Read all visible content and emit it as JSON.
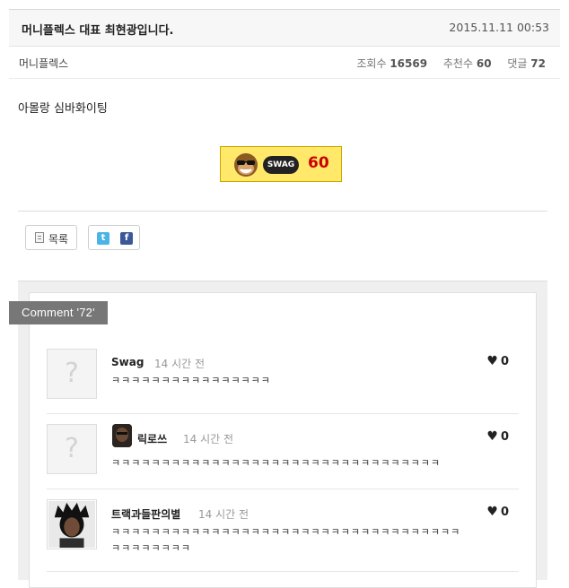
{
  "post": {
    "title": "머니플렉스 대표 최현광입니다.",
    "date": "2015.11.11 00:53",
    "author": "머니플렉스",
    "views_label": "조회수",
    "views": "16569",
    "recommend_label": "추천수",
    "recommend": "60",
    "comments_label": "댓글",
    "comments": "72",
    "body": "아몰랑 심바화이팅"
  },
  "swag": {
    "label": "SWAG",
    "count": "60"
  },
  "buttons": {
    "list_label": "목록",
    "twitter": "t",
    "facebook": "f"
  },
  "comment_section": {
    "tab_label": "Comment '72'",
    "items": [
      {
        "name": "Swag",
        "time": "14 시간 전",
        "likes": "0",
        "text": "ㅋㅋㅋㅋㅋㅋㅋㅋㅋㅋㅋㅋㅋㅋㅋㅋ"
      },
      {
        "name": "릭로쓰",
        "time": "14 시간 전",
        "likes": "0",
        "text": "ㅋㅋㅋㅋㅋㅋㅋㅋㅋㅋㅋㅋㅋㅋㅋㅋㅋㅋㅋㅋㅋㅋㅋㅋㅋㅋㅋㅋㅋㅋㅋㅋㅋ"
      },
      {
        "name": "트랙과들판의별",
        "time": "14 시간 전",
        "likes": "0",
        "text": "ㅋㅋㅋㅋㅋㅋㅋㅋㅋㅋㅋㅋㅋㅋㅋㅋㅋㅋㅋㅋㅋㅋㅋㅋㅋㅋㅋㅋㅋㅋㅋㅋㅋㅋㅋ",
        "text2": "ㅋㅋㅋㅋㅋㅋㅋㅋ"
      }
    ]
  }
}
